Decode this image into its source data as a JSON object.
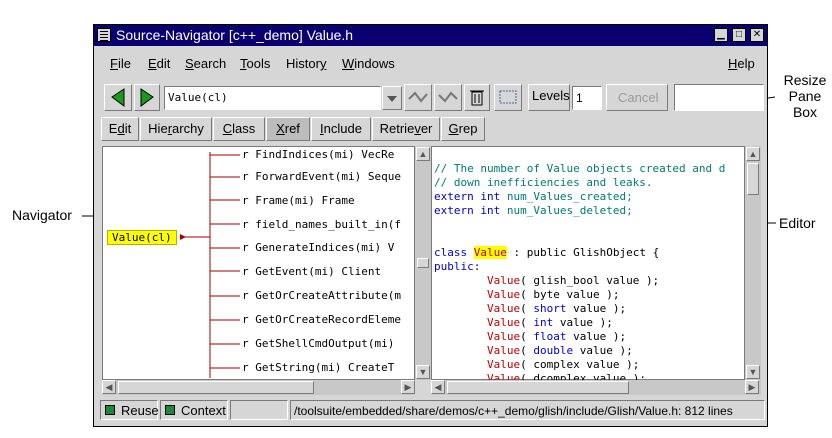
{
  "window": {
    "title": "Source-Navigator [c++_demo] Value.h",
    "minimize": "▁",
    "maximize": "□",
    "close": "✕"
  },
  "menu": {
    "items": [
      "File",
      "Edit",
      "Search",
      "Tools",
      "History",
      "Windows"
    ],
    "help": "Help"
  },
  "toolbar": {
    "symbol_value": "Value(cl)",
    "levels_label": "Levels",
    "levels_value": "1",
    "cancel_label": "Cancel"
  },
  "tabs": [
    "Edit",
    "Hierarchy",
    "Class",
    "Xref",
    "Include",
    "Retriever",
    "Grep"
  ],
  "navigator": {
    "root": "Value(cl)",
    "rows": [
      "r FindIndices(mi) VecRe",
      "r ForwardEvent(mi) Seque",
      "r Frame(mi) Frame",
      "r field_names_built_in(f",
      "r GenerateIndices(mi) V",
      "r GetEvent(mi) Client",
      "r GetOrCreateAttribute(m",
      "r GetOrCreateRecordEleme",
      "r GetShellCmdOutput(mi)",
      "r GetString(mi) CreateT"
    ]
  },
  "editor": {
    "comment1": "// The number of Value objects created and d",
    "comment2": "// down inefficiencies and leaks.",
    "extern": "extern",
    "int": "int",
    "var1": "num_Values_created;",
    "var2": "num_Values_deleted;",
    "class_kw": "class",
    "class_name": "Value",
    "class_rest": " : public GlishObject {",
    "public": "public:",
    "ctor": "Value",
    "ctor_lines": [
      {
        "pre": "( glish_bool value );",
        "kw": "",
        "post": ""
      },
      {
        "pre": "( byte value );",
        "kw": "",
        "post": ""
      },
      {
        "pre": "( ",
        "kw": "short",
        "post": " value );"
      },
      {
        "pre": "( ",
        "kw": "int",
        "post": " value );"
      },
      {
        "pre": "( ",
        "kw": "float",
        "post": " value );"
      },
      {
        "pre": "( ",
        "kw": "double",
        "post": " value );"
      },
      {
        "pre": "( complex value );",
        "kw": "",
        "post": ""
      },
      {
        "pre": "( dcomplex value );",
        "kw": "",
        "post": ""
      }
    ]
  },
  "statusbar": {
    "reuse": "Reuse",
    "context": "Context",
    "path": "/toolsuite/embedded/share/demos/c++_demo/glish/include/Glish/Value.h: 812 lines"
  },
  "annotations": {
    "resize1": "Resize",
    "resize2": "Pane",
    "resize3": "Box",
    "navigator": "Navigator",
    "editor": "Editor"
  },
  "colors": {
    "titlebar": "#0a006f",
    "comment": "#007a7a",
    "keyword": "#0000d0",
    "function": "#c00000",
    "highlight": "#ffff00",
    "tree_line": "#a00000"
  }
}
